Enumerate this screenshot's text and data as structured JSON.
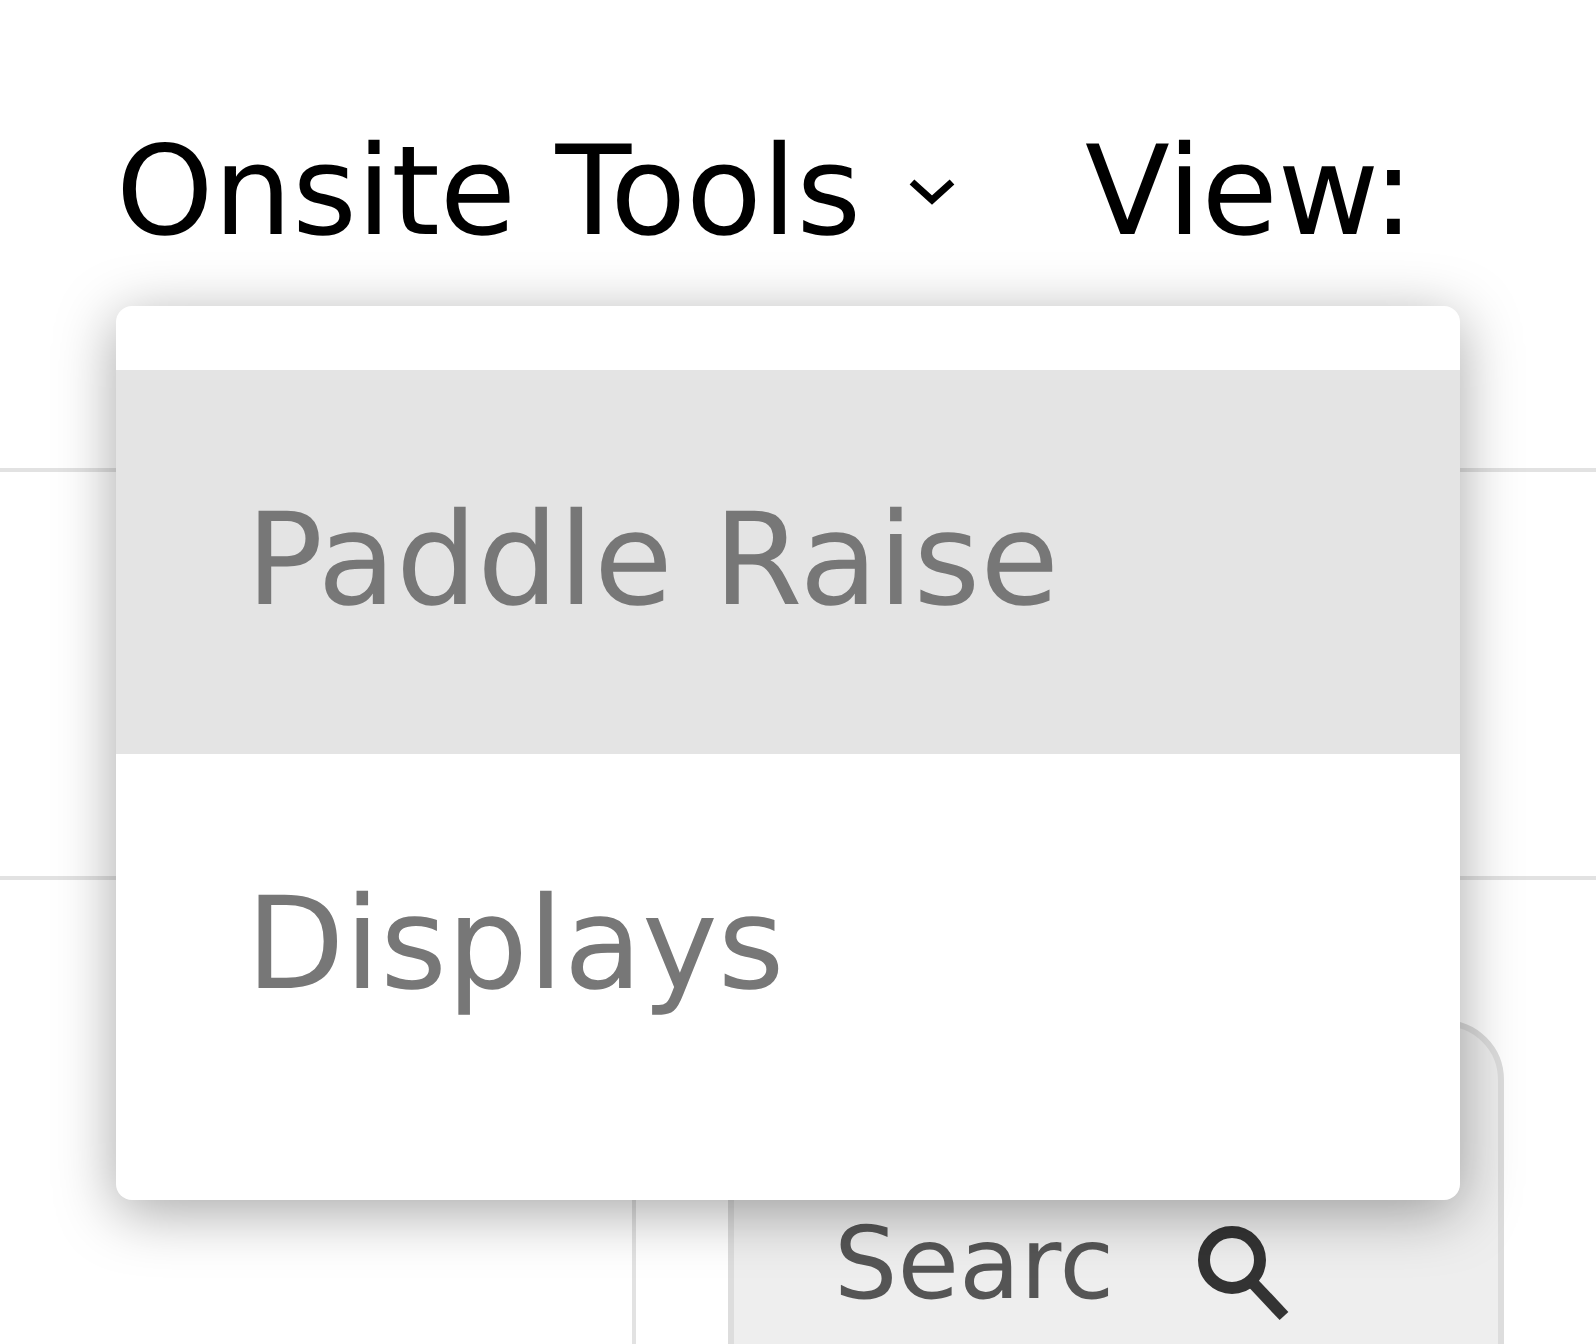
{
  "header": {
    "title": "Onsite Tools",
    "view_label": "View:"
  },
  "search": {
    "value": "Searc"
  },
  "menu": {
    "items": [
      {
        "label": "Paddle Raise",
        "selected": true
      },
      {
        "label": "Displays",
        "selected": false
      }
    ]
  }
}
